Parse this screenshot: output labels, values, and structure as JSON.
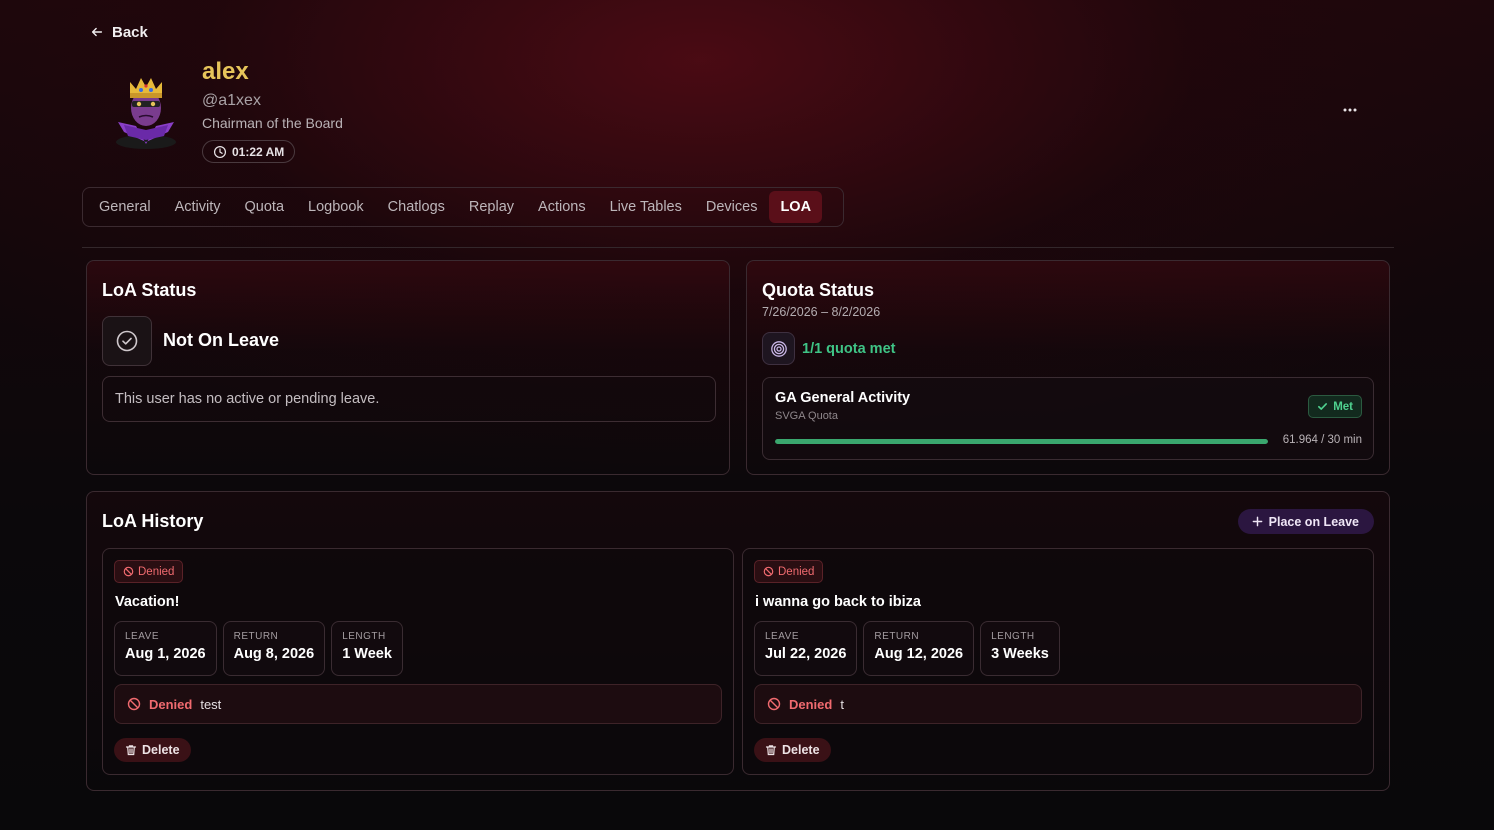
{
  "nav": {
    "back_label": "Back"
  },
  "profile": {
    "name": "alex",
    "handle": "@a1xex",
    "role": "Chairman of the Board",
    "local_time": "01:22 AM"
  },
  "tabs": [
    {
      "label": "General"
    },
    {
      "label": "Activity"
    },
    {
      "label": "Quota"
    },
    {
      "label": "Logbook"
    },
    {
      "label": "Chatlogs"
    },
    {
      "label": "Replay"
    },
    {
      "label": "Actions"
    },
    {
      "label": "Live Tables"
    },
    {
      "label": "Devices"
    },
    {
      "label": "LOA",
      "active": true
    }
  ],
  "loa_status": {
    "title": "LoA Status",
    "status": "Not On Leave",
    "message": "This user has no active or pending leave."
  },
  "quota_status": {
    "title": "Quota Status",
    "range": "7/26/2026 – 8/2/2026",
    "summary": "1/1 quota met",
    "item": {
      "title": "GA General Activity",
      "subtitle": "SVGA Quota",
      "badge": "Met",
      "progress_fraction": 1.0,
      "progress_text": "61.964 / 30 min"
    }
  },
  "history": {
    "title": "LoA History",
    "place_button": "Place on Leave",
    "leave_label": "LEAVE",
    "return_label": "RETURN",
    "length_label": "LENGTH",
    "delete_label": "Delete",
    "items": [
      {
        "status": "Denied",
        "reason": "Vacation!",
        "leave": "Aug 1, 2026",
        "return": "Aug 8, 2026",
        "length": "1 Week",
        "decision_label": "Denied",
        "decision_note": "test"
      },
      {
        "status": "Denied",
        "reason": "i wanna go back to ibiza",
        "leave": "Jul 22, 2026",
        "return": "Aug 12, 2026",
        "length": "3 Weeks",
        "decision_label": "Denied",
        "decision_note": "t"
      }
    ]
  },
  "colors": {
    "accent_gold": "#e6c45a",
    "tab_active_bg": "#5a0f19",
    "success": "#3fc486",
    "danger": "#f06a6f",
    "purple_button": "#2b1640"
  }
}
